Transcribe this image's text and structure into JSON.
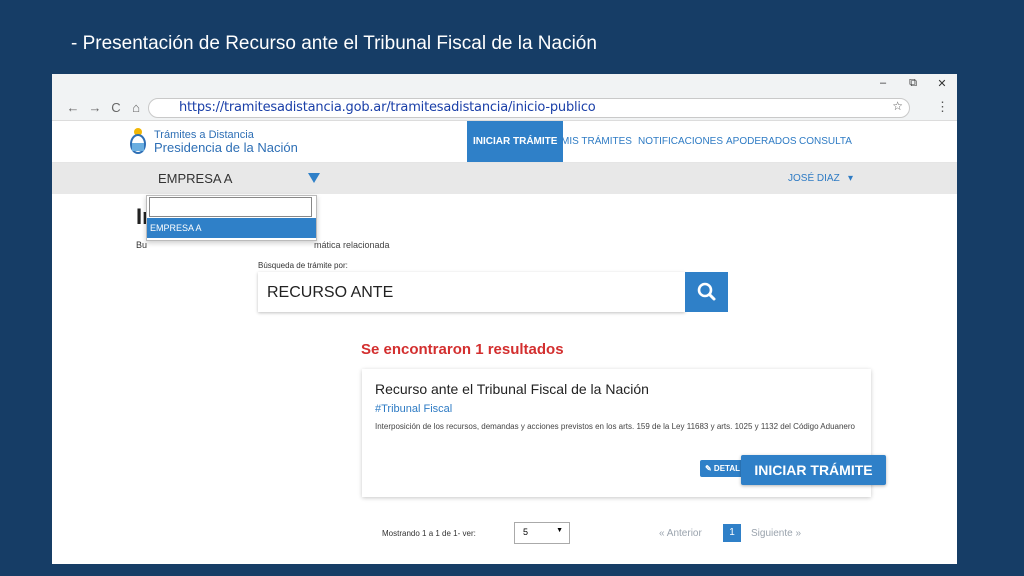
{
  "slide": {
    "title": "- Presentación de Recurso ante el Tribunal Fiscal de la Nación"
  },
  "browser": {
    "url": "https://tramitesadistancia.gob.ar/tramitesadistancia/inicio-publico",
    "controls": {
      "minimize": "–",
      "restore": "⧉",
      "close": "✕"
    },
    "nav": {
      "back": "←",
      "forward": "→",
      "reload": "C",
      "home": "⌂",
      "star": "☆",
      "menu": "⋮"
    }
  },
  "header": {
    "logo_small": "Trámites a Distancia",
    "logo_big": "Presidencia de la Nación",
    "nav": [
      "INICIAR TRÁMITE",
      "MIS TRÁMITES",
      "NOTIFICACIONES",
      "APODERADOS",
      "CONSULTA"
    ]
  },
  "userbar": {
    "company": "EMPRESA  A",
    "user": "JOSÉ DIAZ",
    "user_caret": "▾"
  },
  "dropdown": {
    "options": [
      "EMPRESA A"
    ]
  },
  "page": {
    "heading": "In",
    "sub_left": "Bu",
    "sub_right": "mática relacionada"
  },
  "search": {
    "label": "Búsqueda de trámite por:",
    "value": "RECURSO ANTE"
  },
  "results": {
    "count_text": "Se encontraron 1 resultados",
    "items": [
      {
        "title": "Recurso ante el Tribunal Fiscal de la Nación",
        "tag": "#Tribunal Fiscal",
        "description": "Interposición de los recursos, demandas y acciones previstos en los arts. 159 de la Ley 11683 y arts. 1025 y 1132 del Código Aduanero",
        "detail_label": "✎ DETAL",
        "start_label": "INICIAR TRÁMITE"
      }
    ]
  },
  "pagination": {
    "showing": "Mostrando 1 a 1 de 1- ver:",
    "page_size": "5",
    "page_size_arrow": "▼",
    "prev": "« Anterior",
    "current": "1",
    "next": "Siguiente »"
  },
  "colors": {
    "background": "#163d66",
    "accent": "#2f80c8",
    "alert": "#d32f2f"
  }
}
